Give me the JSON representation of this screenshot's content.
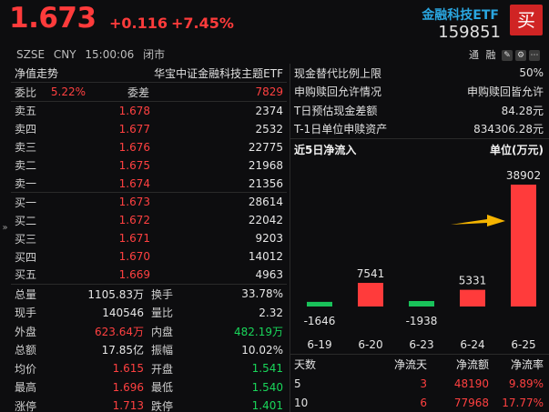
{
  "header": {
    "price": "1.673",
    "change": "+0.116",
    "change_pct": "+7.45%",
    "exchange": "SZSE",
    "currency": "CNY",
    "time": "15:00:06",
    "status": "闭市",
    "etf_name": "金融科技ETF",
    "code": "159851",
    "buy_label": "买",
    "tool_a": "通",
    "tool_b": "融"
  },
  "left": {
    "tab_left": "净值走势",
    "tab_right": "华宝中证金融科技主题ETF",
    "weibi": {
      "label": "委比",
      "value": "5.22%",
      "label2": "委差",
      "value2": "7829"
    },
    "asks": [
      {
        "label": "卖五",
        "price": "1.678",
        "vol": "2374"
      },
      {
        "label": "卖四",
        "price": "1.677",
        "vol": "2532"
      },
      {
        "label": "卖三",
        "price": "1.676",
        "vol": "22775"
      },
      {
        "label": "卖二",
        "price": "1.675",
        "vol": "21968"
      },
      {
        "label": "卖一",
        "price": "1.674",
        "vol": "21356"
      }
    ],
    "bids": [
      {
        "label": "买一",
        "price": "1.673",
        "vol": "28614"
      },
      {
        "label": "买二",
        "price": "1.672",
        "vol": "22042"
      },
      {
        "label": "买三",
        "price": "1.671",
        "vol": "9203"
      },
      {
        "label": "买四",
        "price": "1.670",
        "vol": "14012"
      },
      {
        "label": "买五",
        "price": "1.669",
        "vol": "4963"
      }
    ],
    "stats": [
      {
        "k1": "总量",
        "v1": "1105.83万",
        "k2": "换手",
        "v2": "33.78%"
      },
      {
        "k1": "现手",
        "v1": "140546",
        "k2": "量比",
        "v2": "2.32"
      },
      {
        "k1": "外盘",
        "v1": "623.64万",
        "k2": "内盘",
        "v2": "482.19万"
      },
      {
        "k1": "总额",
        "v1": "17.85亿",
        "k2": "振幅",
        "v2": "10.02%"
      },
      {
        "k1": "均价",
        "v1": "1.615",
        "k2": "开盘",
        "v2": "1.541"
      },
      {
        "k1": "最高",
        "v1": "1.696",
        "k2": "最低",
        "v2": "1.540"
      },
      {
        "k1": "涨停",
        "v1": "1.713",
        "k2": "跌停",
        "v2": "1.401"
      }
    ],
    "stat_colors": [
      [
        "#e6e6e6",
        "#e6e6e6"
      ],
      [
        "#e6e6e6",
        "#e6e6e6"
      ],
      [
        "#ff4040",
        "#19d65a"
      ],
      [
        "#e6e6e6",
        "#e6e6e6"
      ],
      [
        "#ff4040",
        "#19d65a"
      ],
      [
        "#ff4040",
        "#19d65a"
      ],
      [
        "#ff4040",
        "#19d65a"
      ]
    ]
  },
  "right": {
    "info": [
      {
        "k": "现金替代比例上限",
        "v": "50%"
      },
      {
        "k": "申购赎回允许情况",
        "v": "申购赎回皆允许"
      },
      {
        "k": "T日预估现金差额",
        "v": "84.28元"
      },
      {
        "k": "T-1日单位申赎资产",
        "v": "834306.28元"
      }
    ],
    "flow_title": "近5日净流入",
    "flow_unit": "单位(万元)",
    "table_headers": [
      "天数",
      "净流天",
      "净流额",
      "净流率"
    ],
    "table_rows": [
      {
        "days": "5",
        "flow_days": "3",
        "amount": "48190",
        "rate": "9.89%"
      },
      {
        "days": "10",
        "flow_days": "6",
        "amount": "77968",
        "rate": "17.77%"
      }
    ]
  },
  "chart_data": {
    "type": "bar",
    "title": "近5日净流入",
    "unit": "单位(万元)",
    "categories": [
      "6-19",
      "6-20",
      "6-23",
      "6-24",
      "6-25"
    ],
    "values": [
      -1646,
      7541,
      -1938,
      5331,
      38902
    ],
    "labels": [
      "-1646",
      "7541",
      "-1938",
      "5331",
      "38902"
    ],
    "colors": {
      "positive": "#ff3b3b",
      "negative": "#19c25a",
      "arrow": "#f5b400"
    }
  }
}
